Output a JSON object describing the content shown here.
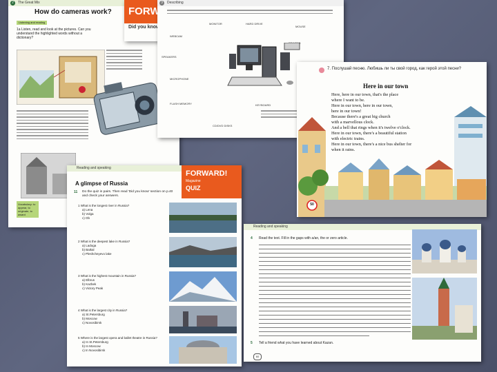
{
  "page_cameras": {
    "unit_tag": "The Great Mix",
    "title": "How do cameras work?",
    "section": "Listening and reading",
    "task": "1a  Listen, read and look at the pictures. Can you understand the highlighted words without a dictionary?"
  },
  "page_forward_top": {
    "banner": "FORWARD",
    "sub": "Did you know"
  },
  "page_computer": {
    "section": "Describing",
    "labels": [
      "MONITOR",
      "HARD DRIVE",
      "SPEAKERS",
      "PRINTER",
      "WEBCAM",
      "MICROPHONE",
      "FLASH MEMORY",
      "KEYBOARD",
      "MOUSE",
      "CD/DVD DISKS"
    ]
  },
  "page_town": {
    "task": "7. Послушай песню. Любишь ли ты свой город, как герой этой песни?",
    "poem_title": "Here in our town",
    "poem_lines": [
      "Here, here in our town, that's the place",
      "where I want to be.",
      "Here in our town, here in our town,",
      "here in our town!",
      "Because there's a great big church",
      "with a marvellous clock.",
      "And a bell that rings when it's twelve o'clock.",
      "Here in our town, there's a beautiful station",
      "with electric trains.",
      "Here in our town, there's a nice bus shelter for",
      "when it rains."
    ],
    "speed_sign": "50"
  },
  "page_quiz": {
    "section": "Reading and speaking",
    "title": "A glimpse of Russia",
    "banner": "FORWARD!",
    "banner_sub": "Magazine",
    "banner_quiz": "QUIZ",
    "task_num": "11",
    "task": "Do the quiz in pairs. Then read 'Did you know' section on p.40 and check your answers.",
    "side_note": "Vocabulary: to appear, to originate, to award",
    "questions": [
      {
        "q": "1  What is the longest river in Russia?",
        "opts": [
          "a) Lena",
          "b) Volga",
          "c) Ob"
        ]
      },
      {
        "q": "2  What is the deepest lake in Russia?",
        "opts": [
          "a) Ladoga",
          "b) Baikal",
          "c) Pleshcheyevo lake"
        ]
      },
      {
        "q": "3  What is the highest mountain in Russia?",
        "opts": [
          "a) Elbrus",
          "b) Kazbek",
          "c) Victory Peak"
        ]
      },
      {
        "q": "4  What is the largest city in Russia?",
        "opts": [
          "a) St.Petersburg",
          "b) Moscow",
          "c) Novosibirsk"
        ]
      },
      {
        "q": "5  Where is the largest opera and ballet theatre in Russia?",
        "opts": [
          "a) In St.Petersburg",
          "b) In Moscow",
          "c) In Novosibirsk"
        ]
      }
    ]
  },
  "page_kazan": {
    "section": "Reading and speaking",
    "task_num": "4",
    "task": "Read the text. Fill in the gaps with a/an, the or zero article.",
    "task2_num": "5",
    "task2": "Tell a friend what you have learned about Kazan."
  },
  "colors": {
    "orange": "#e95a1e",
    "green": "#2a6b3a",
    "pink": "#e88a9a"
  }
}
